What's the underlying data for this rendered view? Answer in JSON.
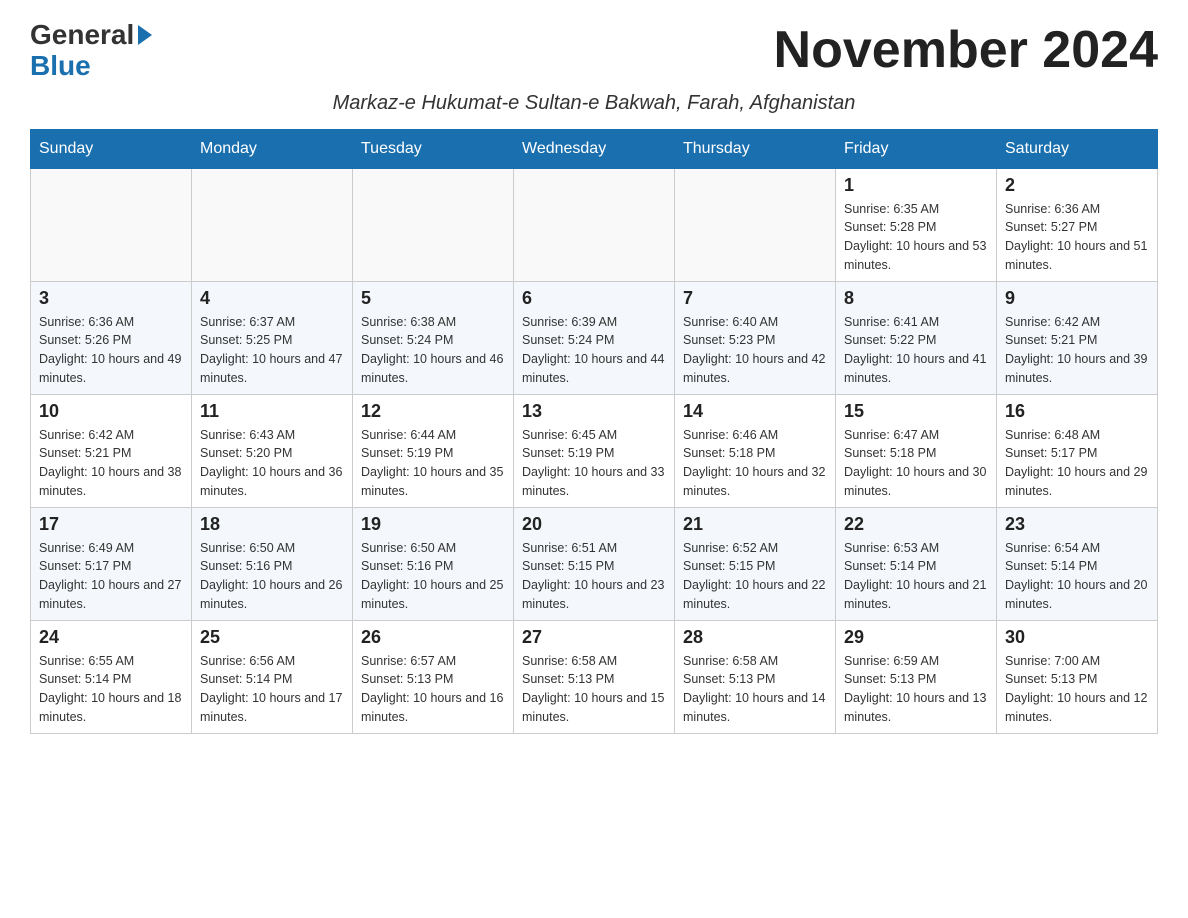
{
  "header": {
    "logo_general": "General",
    "logo_blue": "Blue",
    "month_title": "November 2024",
    "location": "Markaz-e Hukumat-e Sultan-e Bakwah, Farah, Afghanistan"
  },
  "weekdays": [
    "Sunday",
    "Monday",
    "Tuesday",
    "Wednesday",
    "Thursday",
    "Friday",
    "Saturday"
  ],
  "weeks": [
    {
      "days": [
        {
          "num": "",
          "info": ""
        },
        {
          "num": "",
          "info": ""
        },
        {
          "num": "",
          "info": ""
        },
        {
          "num": "",
          "info": ""
        },
        {
          "num": "",
          "info": ""
        },
        {
          "num": "1",
          "info": "Sunrise: 6:35 AM\nSunset: 5:28 PM\nDaylight: 10 hours and 53 minutes."
        },
        {
          "num": "2",
          "info": "Sunrise: 6:36 AM\nSunset: 5:27 PM\nDaylight: 10 hours and 51 minutes."
        }
      ]
    },
    {
      "days": [
        {
          "num": "3",
          "info": "Sunrise: 6:36 AM\nSunset: 5:26 PM\nDaylight: 10 hours and 49 minutes."
        },
        {
          "num": "4",
          "info": "Sunrise: 6:37 AM\nSunset: 5:25 PM\nDaylight: 10 hours and 47 minutes."
        },
        {
          "num": "5",
          "info": "Sunrise: 6:38 AM\nSunset: 5:24 PM\nDaylight: 10 hours and 46 minutes."
        },
        {
          "num": "6",
          "info": "Sunrise: 6:39 AM\nSunset: 5:24 PM\nDaylight: 10 hours and 44 minutes."
        },
        {
          "num": "7",
          "info": "Sunrise: 6:40 AM\nSunset: 5:23 PM\nDaylight: 10 hours and 42 minutes."
        },
        {
          "num": "8",
          "info": "Sunrise: 6:41 AM\nSunset: 5:22 PM\nDaylight: 10 hours and 41 minutes."
        },
        {
          "num": "9",
          "info": "Sunrise: 6:42 AM\nSunset: 5:21 PM\nDaylight: 10 hours and 39 minutes."
        }
      ]
    },
    {
      "days": [
        {
          "num": "10",
          "info": "Sunrise: 6:42 AM\nSunset: 5:21 PM\nDaylight: 10 hours and 38 minutes."
        },
        {
          "num": "11",
          "info": "Sunrise: 6:43 AM\nSunset: 5:20 PM\nDaylight: 10 hours and 36 minutes."
        },
        {
          "num": "12",
          "info": "Sunrise: 6:44 AM\nSunset: 5:19 PM\nDaylight: 10 hours and 35 minutes."
        },
        {
          "num": "13",
          "info": "Sunrise: 6:45 AM\nSunset: 5:19 PM\nDaylight: 10 hours and 33 minutes."
        },
        {
          "num": "14",
          "info": "Sunrise: 6:46 AM\nSunset: 5:18 PM\nDaylight: 10 hours and 32 minutes."
        },
        {
          "num": "15",
          "info": "Sunrise: 6:47 AM\nSunset: 5:18 PM\nDaylight: 10 hours and 30 minutes."
        },
        {
          "num": "16",
          "info": "Sunrise: 6:48 AM\nSunset: 5:17 PM\nDaylight: 10 hours and 29 minutes."
        }
      ]
    },
    {
      "days": [
        {
          "num": "17",
          "info": "Sunrise: 6:49 AM\nSunset: 5:17 PM\nDaylight: 10 hours and 27 minutes."
        },
        {
          "num": "18",
          "info": "Sunrise: 6:50 AM\nSunset: 5:16 PM\nDaylight: 10 hours and 26 minutes."
        },
        {
          "num": "19",
          "info": "Sunrise: 6:50 AM\nSunset: 5:16 PM\nDaylight: 10 hours and 25 minutes."
        },
        {
          "num": "20",
          "info": "Sunrise: 6:51 AM\nSunset: 5:15 PM\nDaylight: 10 hours and 23 minutes."
        },
        {
          "num": "21",
          "info": "Sunrise: 6:52 AM\nSunset: 5:15 PM\nDaylight: 10 hours and 22 minutes."
        },
        {
          "num": "22",
          "info": "Sunrise: 6:53 AM\nSunset: 5:14 PM\nDaylight: 10 hours and 21 minutes."
        },
        {
          "num": "23",
          "info": "Sunrise: 6:54 AM\nSunset: 5:14 PM\nDaylight: 10 hours and 20 minutes."
        }
      ]
    },
    {
      "days": [
        {
          "num": "24",
          "info": "Sunrise: 6:55 AM\nSunset: 5:14 PM\nDaylight: 10 hours and 18 minutes."
        },
        {
          "num": "25",
          "info": "Sunrise: 6:56 AM\nSunset: 5:14 PM\nDaylight: 10 hours and 17 minutes."
        },
        {
          "num": "26",
          "info": "Sunrise: 6:57 AM\nSunset: 5:13 PM\nDaylight: 10 hours and 16 minutes."
        },
        {
          "num": "27",
          "info": "Sunrise: 6:58 AM\nSunset: 5:13 PM\nDaylight: 10 hours and 15 minutes."
        },
        {
          "num": "28",
          "info": "Sunrise: 6:58 AM\nSunset: 5:13 PM\nDaylight: 10 hours and 14 minutes."
        },
        {
          "num": "29",
          "info": "Sunrise: 6:59 AM\nSunset: 5:13 PM\nDaylight: 10 hours and 13 minutes."
        },
        {
          "num": "30",
          "info": "Sunrise: 7:00 AM\nSunset: 5:13 PM\nDaylight: 10 hours and 12 minutes."
        }
      ]
    }
  ]
}
